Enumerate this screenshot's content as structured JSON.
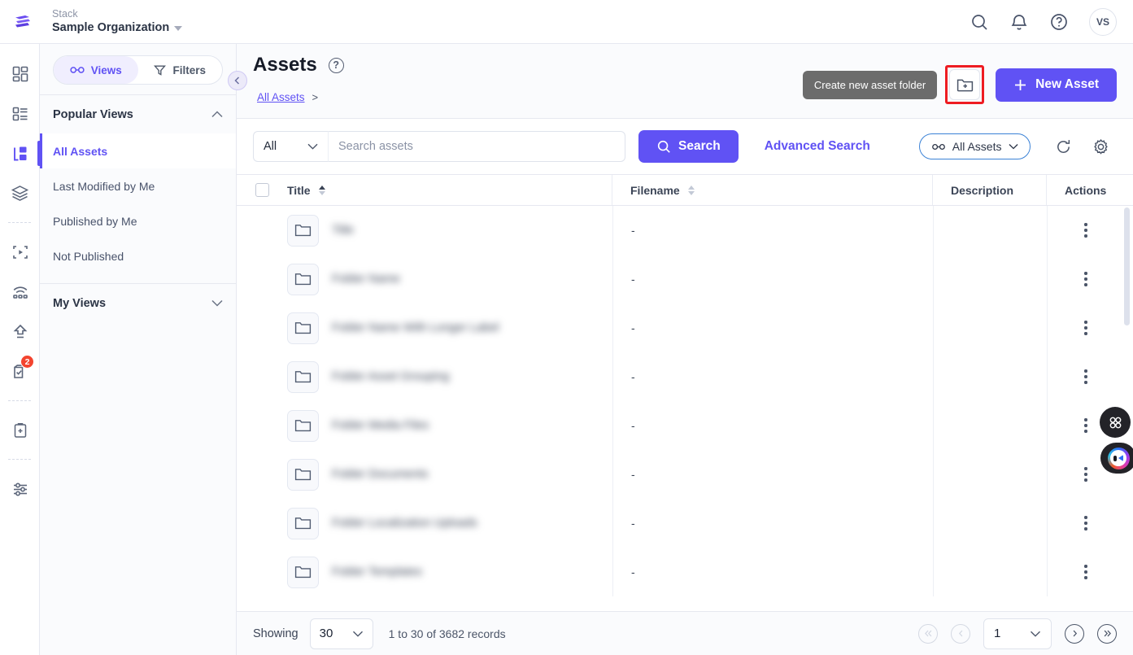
{
  "header": {
    "org_label": "Stack",
    "org_name": "Sample Organization",
    "icons": {
      "search": "search-icon",
      "notifications": "bell-icon",
      "help": "question-circle-icon"
    },
    "avatar_initials": "VS"
  },
  "rail": {
    "items": [
      {
        "name": "dashboard-icon",
        "badge": ""
      },
      {
        "name": "content-types-icon",
        "badge": ""
      },
      {
        "name": "entries-icon",
        "badge": ""
      },
      {
        "name": "assets-icon",
        "badge": ""
      },
      {
        "name": "releases-icon",
        "badge": ""
      },
      {
        "name": "live-preview-icon",
        "badge": ""
      },
      {
        "name": "publish-queue-icon",
        "badge": ""
      },
      {
        "name": "workflow-icon",
        "badge": "2"
      },
      {
        "name": "audit-log-icon",
        "badge": ""
      },
      {
        "name": "settings-sliders-icon",
        "badge": ""
      }
    ]
  },
  "views_panel": {
    "toggle": {
      "views_label": "Views",
      "filters_label": "Filters"
    },
    "groups": [
      {
        "title": "Popular Views",
        "expanded": true,
        "items": [
          {
            "label": "All Assets",
            "selected": true
          },
          {
            "label": "Last Modified by Me",
            "selected": false
          },
          {
            "label": "Published by Me",
            "selected": false
          },
          {
            "label": "Not Published",
            "selected": false
          }
        ]
      },
      {
        "title": "My Views",
        "expanded": false,
        "items": []
      }
    ]
  },
  "main": {
    "page_title": "Assets",
    "breadcrumb": {
      "label": "All Assets",
      "separator": ">"
    },
    "tooltip": "Create new asset folder",
    "create_folder_button": "create-asset-folder-button",
    "new_asset_button": "New Asset",
    "search": {
      "scope_value": "All",
      "placeholder": "Search assets",
      "value": "",
      "search_button": "Search",
      "advanced_search": "Advanced Search",
      "asset_scope_pill": "All Assets"
    },
    "table": {
      "columns": [
        {
          "label": "",
          "key": "check"
        },
        {
          "label": "Title",
          "key": "title",
          "sort": "asc"
        },
        {
          "label": "Filename",
          "key": "filename",
          "sort": "none"
        },
        {
          "label": "Description",
          "key": "description",
          "sort": "none"
        },
        {
          "label": "Actions",
          "key": "actions",
          "sort": "none"
        }
      ],
      "rows": [
        {
          "title": "",
          "redacted": true,
          "filename": "-",
          "description": ""
        },
        {
          "title": "",
          "redacted": true,
          "filename": "-",
          "description": ""
        },
        {
          "title": "",
          "redacted": true,
          "filename": "-",
          "description": ""
        },
        {
          "title": "",
          "redacted": true,
          "filename": "-",
          "description": ""
        },
        {
          "title": "",
          "redacted": true,
          "filename": "-",
          "description": ""
        },
        {
          "title": "",
          "redacted": true,
          "filename": "-",
          "description": ""
        },
        {
          "title": "",
          "redacted": true,
          "filename": "-",
          "description": ""
        },
        {
          "title": "",
          "redacted": true,
          "filename": "-",
          "description": ""
        }
      ]
    }
  },
  "footer": {
    "showing_label": "Showing",
    "page_size": "30",
    "records_label": "1 to 30 of 3682 records",
    "current_page": "1",
    "first_enabled": false,
    "prev_enabled": false,
    "next_enabled": true,
    "last_enabled": true
  },
  "floating": {
    "apps_button": "apps-grid-icon",
    "bot_button": "assistant-bot-icon"
  },
  "colors": {
    "accent": "#6052f4",
    "tooltip_bg": "#6c6c6c",
    "highlight_red": "#ee1c22",
    "badge_red": "#f3442f",
    "pill_border_blue": "#3b82d6"
  }
}
